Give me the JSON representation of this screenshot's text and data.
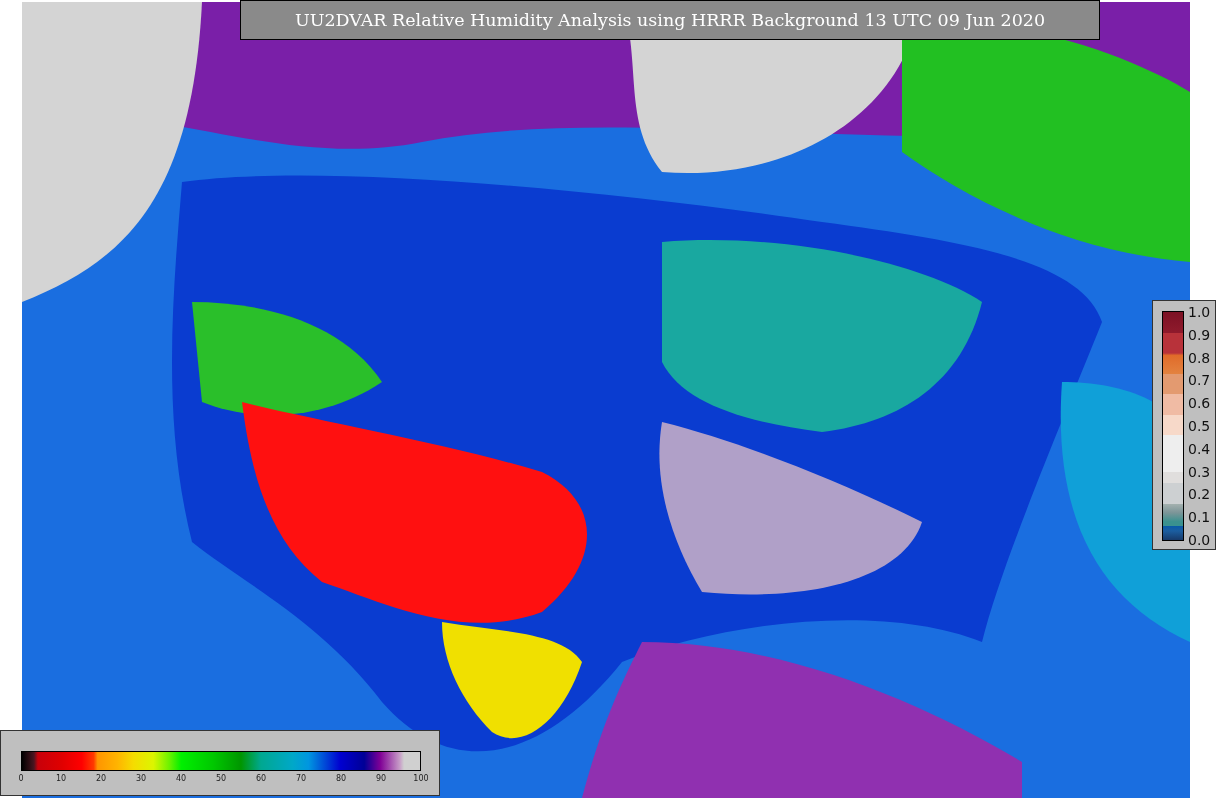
{
  "title": "UU2DVAR Relative Humidity Analysis using HRRR Background 13 UTC 09 Jun 2020",
  "weight_legend": {
    "ticks": [
      "1.0",
      "0.9",
      "0.8",
      "0.7",
      "0.6",
      "0.5",
      "0.4",
      "0.3",
      "0.2",
      "0.1",
      "0.0"
    ]
  },
  "humidity_legend": {
    "ticks": [
      "0",
      "10",
      "20",
      "30",
      "40",
      "50",
      "60",
      "70",
      "80",
      "90",
      "100"
    ]
  }
}
